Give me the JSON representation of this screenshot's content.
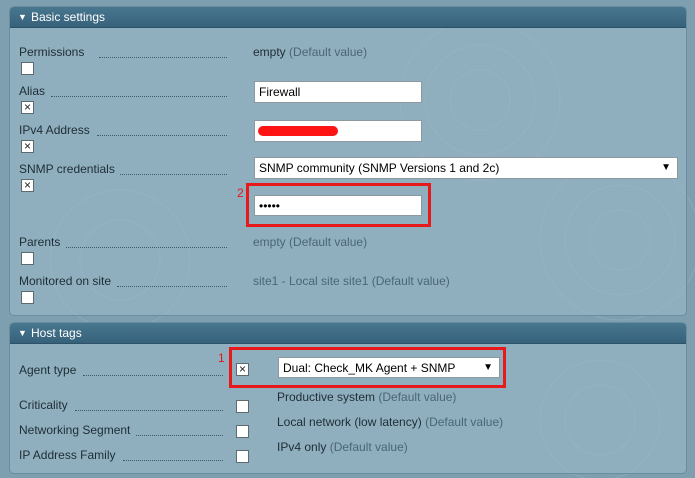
{
  "basic_settings": {
    "header": "Basic settings",
    "rows": [
      {
        "label": "Permissions",
        "value": "empty",
        "default": "(Default value)"
      },
      {
        "label": "Alias",
        "value": "Firewall"
      },
      {
        "label": "IPv4 Address",
        "value": ""
      },
      {
        "label": "SNMP credentials",
        "select": "SNMP community (SNMP Versions 1 and 2c)",
        "password": "•••••"
      },
      {
        "label": "Parents",
        "value": "empty",
        "default": "(Default value)"
      },
      {
        "label": "Monitored on site",
        "value": "site1 - Local site site1",
        "default": "(Default value)"
      }
    ],
    "annotation": "2"
  },
  "host_tags": {
    "header": "Host tags",
    "rows": [
      {
        "label": "Agent type",
        "select": "Dual: Check_MK Agent + SNMP"
      },
      {
        "label": "Criticality",
        "value": "Productive system",
        "default": "(Default value)"
      },
      {
        "label": "Networking Segment",
        "value": "Local network (low latency)",
        "default": "(Default value)"
      },
      {
        "label": "IP Address Family",
        "value": "IPv4 only",
        "default": "(Default value)"
      }
    ],
    "annotation": "1"
  },
  "icons": {
    "collapse": "triangle-down-icon",
    "dropdown": "caret-down-icon",
    "checked": "x-mark"
  },
  "colors": {
    "header": "#3e6a83",
    "highlight": "#e8191a",
    "redaction": "#ff1414"
  }
}
